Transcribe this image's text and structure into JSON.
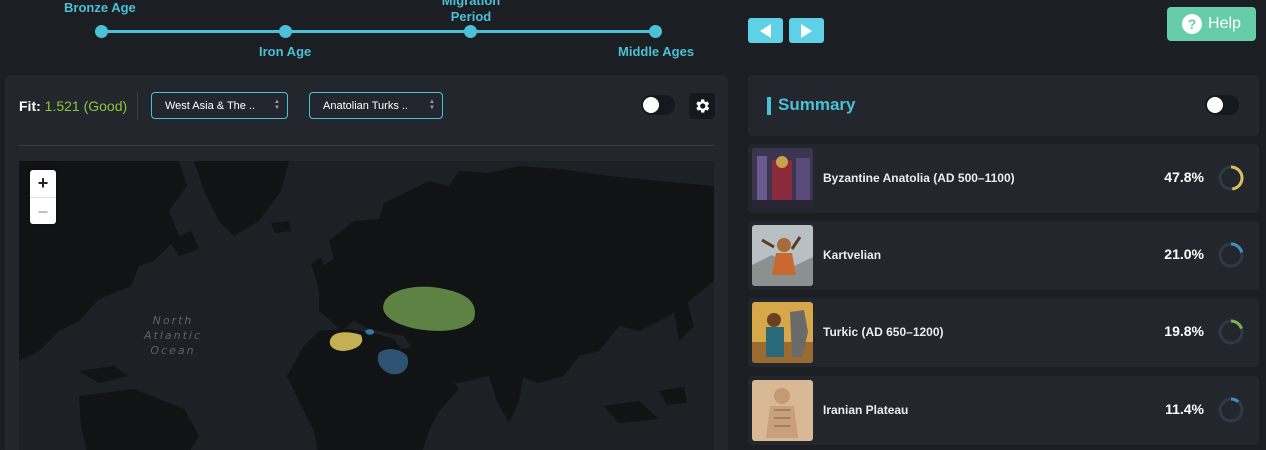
{
  "timeline": {
    "periods": [
      {
        "label": "Bronze Age"
      },
      {
        "label": "Iron Age"
      },
      {
        "label": "Migration Period"
      },
      {
        "label": "Middle Ages"
      }
    ]
  },
  "nav": {
    "prev_icon": "arrow-left-icon",
    "next_icon": "arrow-right-icon"
  },
  "help": {
    "icon": "question-circle-icon",
    "label": "Help"
  },
  "toolbar": {
    "fit_label": "Fit:",
    "fit_value": "1.521 (Good)",
    "region_select": "West Asia & The ..",
    "population_select": "Anatolian Turks ..",
    "settings_icon": "gear-icon"
  },
  "map": {
    "zoom_in": "+",
    "zoom_out": "–",
    "ocean_label": [
      "North",
      "Atlantic",
      "Ocean"
    ]
  },
  "summary": {
    "title": "Summary",
    "items": [
      {
        "name": "Byzantine Anatolia (AD 500–1100)",
        "percent": "47.8%",
        "value": 0.478,
        "color": "#d9c15a"
      },
      {
        "name": "Kartvelian",
        "percent": "21.0%",
        "value": 0.21,
        "color": "#3f8fc7"
      },
      {
        "name": "Turkic (AD 650–1200)",
        "percent": "19.8%",
        "value": 0.198,
        "color": "#7fb257"
      },
      {
        "name": "Iranian Plateau",
        "percent": "11.4%",
        "value": 0.114,
        "color": "#3f8fc7"
      }
    ]
  }
}
